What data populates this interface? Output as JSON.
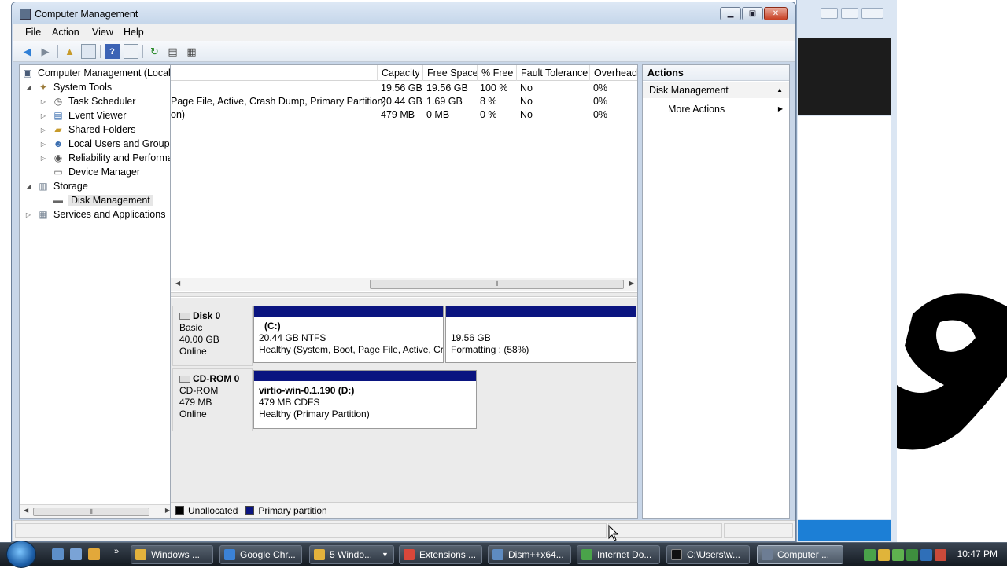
{
  "window": {
    "title": "Computer Management"
  },
  "menu": [
    "File",
    "Action",
    "View",
    "Help"
  ],
  "tree": {
    "root": "Computer Management (Local",
    "system_tools": "System Tools",
    "task_scheduler": "Task Scheduler",
    "event_viewer": "Event Viewer",
    "shared_folders": "Shared Folders",
    "local_users": "Local Users and Groups",
    "reliability": "Reliability and Performa",
    "device_manager": "Device Manager",
    "storage": "Storage",
    "disk_management": "Disk Management",
    "services": "Services and Applications"
  },
  "columns": [
    "Capacity",
    "Free Space",
    "% Free",
    "Fault Tolerance",
    "Overhead"
  ],
  "volumes": [
    {
      "name": "",
      "capacity": "19.56 GB",
      "free": "19.56 GB",
      "pct": "100 %",
      "fault": "No",
      "overhead": "0%"
    },
    {
      "name": "Page File, Active, Crash Dump, Primary Partition)",
      "capacity": "20.44 GB",
      "free": "1.69 GB",
      "pct": "8 %",
      "fault": "No",
      "overhead": "0%"
    },
    {
      "name": "on)",
      "capacity": "479 MB",
      "free": "0 MB",
      "pct": "0 %",
      "fault": "No",
      "overhead": "0%"
    }
  ],
  "disks": {
    "disk0": {
      "name": "Disk 0",
      "type": "Basic",
      "size": "40.00 GB",
      "status": "Online"
    },
    "disk0_c": {
      "label": "(C:)",
      "size": "20.44 GB NTFS",
      "status": "Healthy (System, Boot, Page File, Active, Cr"
    },
    "disk0_new": {
      "size": "19.56 GB",
      "status": "Formatting : (58%)"
    },
    "cdrom0": {
      "name": "CD-ROM 0",
      "type": "CD-ROM",
      "size": "479 MB",
      "status": "Online"
    },
    "cdrom0_d": {
      "label": "virtio-win-0.1.190  (D:)",
      "size": "479 MB CDFS",
      "status": "Healthy (Primary Partition)"
    }
  },
  "legend": {
    "unallocated": "Unallocated",
    "primary": "Primary partition"
  },
  "legend_colors": {
    "unallocated": "#000000",
    "primary": "#0a1480"
  },
  "actions": {
    "header": "Actions",
    "section": "Disk Management",
    "more": "More Actions"
  },
  "taskbar": {
    "items": [
      "Windows ...",
      "Google Chr...",
      "5 Windo...",
      "Extensions ...",
      "Dism++x64...",
      "Internet Do...",
      "C:\\Users\\w...",
      "Computer ..."
    ],
    "clock": "10:47 PM"
  }
}
